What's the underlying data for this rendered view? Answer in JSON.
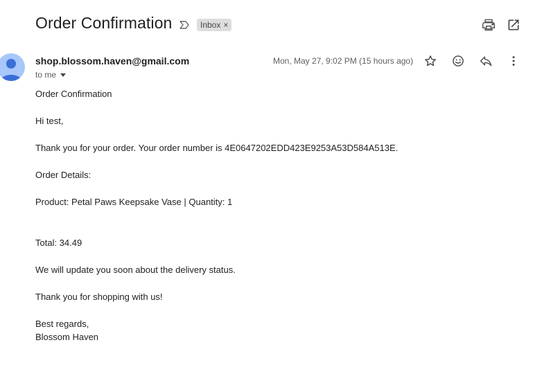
{
  "header": {
    "subject": "Order Confirmation",
    "label_chip": "Inbox",
    "label_remove_glyph": "×",
    "icons": [
      "label-arrow-icon",
      "print-icon",
      "open-in-new-window-icon"
    ]
  },
  "message": {
    "sender_email": "shop.blossom.haven@gmail.com",
    "recipient_text": "to me",
    "date": "Mon, May 27, 9:02 PM (15 hours ago)",
    "action_icons": [
      "star-icon",
      "emoji-reaction-icon",
      "reply-icon",
      "more-vert-icon"
    ]
  },
  "body": {
    "heading": "Order Confirmation",
    "greeting": "Hi test,",
    "thanks_order": "Thank you for your order. Your order number is 4E0647202EDD423E9253A53D584A513E.",
    "details_heading": "Order Details:",
    "product_line": "Product: Petal Paws Keepsake Vase | Quantity: 1",
    "total_line": "Total: 34.49",
    "delivery_update": "We will update you soon about the delivery status.",
    "thanks_shopping": "Thank you for shopping with us!",
    "sign_off": "Best regards,",
    "signature": "Blossom Haven"
  },
  "colors": {
    "avatar_bg": "#a8c7fa",
    "avatar_fg": "#3a6fd8",
    "chip_bg": "#dddddd",
    "icon": "#444746"
  }
}
